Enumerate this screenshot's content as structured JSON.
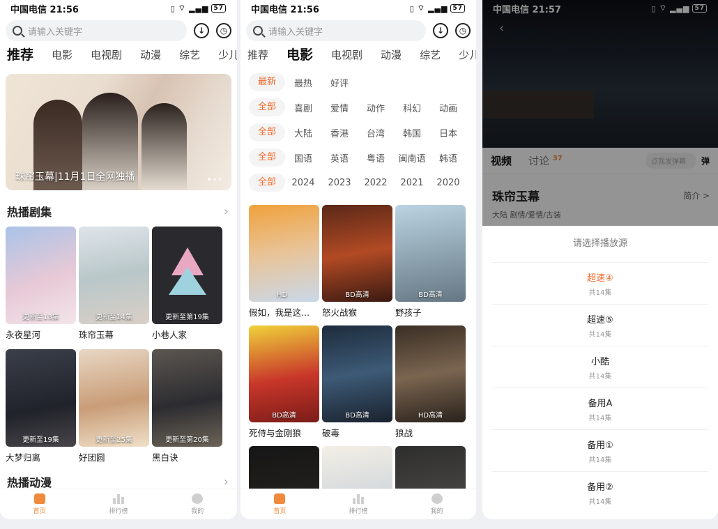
{
  "status": {
    "carrier_time_1": "中国电信 21:56",
    "carrier_time_2": "中国电信 21:56",
    "carrier_time_3": "中国电信 21:57",
    "signal": "5G",
    "battery": "57"
  },
  "search": {
    "placeholder": "请输入关键字"
  },
  "tabs": [
    "推荐",
    "电影",
    "电视剧",
    "动漫",
    "综艺",
    "少儿"
  ],
  "home": {
    "active_tab": "推荐",
    "banner_caption": "珠帘玉幕|11月1日全网独播",
    "banner_pages": 3,
    "hot_dramas_title": "热播剧集",
    "hot_dramas": [
      {
        "title": "永夜星河",
        "badge": "更新至13集"
      },
      {
        "title": "珠帘玉幕",
        "badge": "更新至14集"
      },
      {
        "title": "小巷人家",
        "badge": "更新至第19集"
      },
      {
        "title": "大梦归离",
        "badge": "更新至19集"
      },
      {
        "title": "好团圆",
        "badge": "更新至25集"
      },
      {
        "title": "黑白诀",
        "badge": "更新至第20集"
      }
    ],
    "next_section_title": "热播动漫"
  },
  "movies": {
    "active_tab": "电影",
    "filters": [
      [
        "最新",
        "最热",
        "好评"
      ],
      [
        "全部",
        "喜剧",
        "爱情",
        "动作",
        "科幻",
        "动画"
      ],
      [
        "全部",
        "大陆",
        "香港",
        "台湾",
        "韩国",
        "日本"
      ],
      [
        "全部",
        "国语",
        "英语",
        "粤语",
        "闽南语",
        "韩语"
      ],
      [
        "全部",
        "2024",
        "2023",
        "2022",
        "2021",
        "2020"
      ]
    ],
    "items": [
      {
        "title": "假如，我是这...",
        "badge": "HD"
      },
      {
        "title": "怒火战猴",
        "badge": "BD高清"
      },
      {
        "title": "野孩子",
        "badge": "BD高清"
      },
      {
        "title": "死侍与金刚狼",
        "badge": "BD高清"
      },
      {
        "title": "破毒",
        "badge": "BD高清"
      },
      {
        "title": "狼战",
        "badge": "HD高清"
      }
    ]
  },
  "bottom_nav": [
    "首页",
    "排行榜",
    "我的"
  ],
  "detail": {
    "tab_video": "视频",
    "tab_discuss": "讨论",
    "discuss_count": "37",
    "danmu_placeholder": "点我发弹幕",
    "danmu_toggle": "弹",
    "title": "珠帘玉幕",
    "intro_link": "简介 >",
    "tags": "大陆  剧情/爱情/古装",
    "sheet_title": "请选择播放源",
    "sources": [
      {
        "name": "超速④",
        "count": "共14集",
        "selected": true
      },
      {
        "name": "超速⑤",
        "count": "共14集",
        "selected": false
      },
      {
        "name": "小酷",
        "count": "共14集",
        "selected": false
      },
      {
        "name": "备用A",
        "count": "共14集",
        "selected": false
      },
      {
        "name": "备用①",
        "count": "共14集",
        "selected": false
      },
      {
        "name": "备用②",
        "count": "共14集",
        "selected": false
      }
    ]
  },
  "colors": {
    "accent": "#f06a2c",
    "nav_active": "#f08a3c"
  }
}
